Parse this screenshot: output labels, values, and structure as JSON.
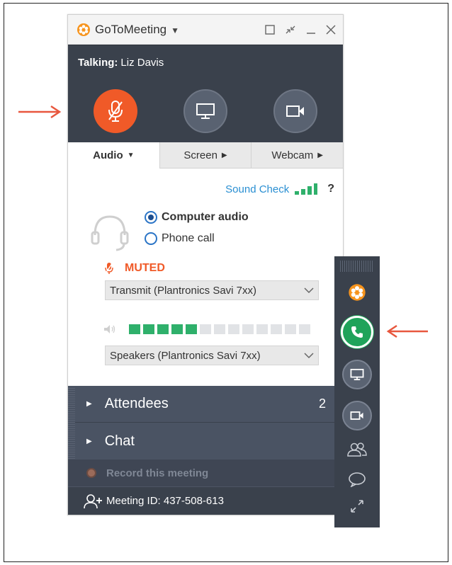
{
  "window": {
    "app_name": "GoToMeeting",
    "talking_label": "Talking:",
    "talking_name": "Liz Davis"
  },
  "tabs": [
    {
      "label": "Audio",
      "active": true
    },
    {
      "label": "Screen",
      "active": false
    },
    {
      "label": "Webcam",
      "active": false
    }
  ],
  "audio": {
    "sound_check": "Sound Check",
    "help": "?",
    "option_computer": "Computer audio",
    "option_phone": "Phone call",
    "selected": "Computer audio",
    "muted_label": "MUTED",
    "transmit_device": "Transmit (Plantronics Savi 7xx)",
    "speaker_device": "Speakers (Plantronics Savi 7xx)",
    "volume_level_segments": 5,
    "volume_total_segments": 13
  },
  "panels": {
    "attendees_label": "Attendees",
    "attendees_count": "2",
    "chat_label": "Chat",
    "record_label": "Record this meeting",
    "meeting_id": "Meeting ID: 437-508-613"
  },
  "icons": {
    "logo": "gotomeeting-logo-icon",
    "mic": "mic-muted-icon",
    "screen": "screen-icon",
    "webcam": "webcam-icon",
    "phone": "phone-icon",
    "attendees": "people-icon",
    "chat": "chat-bubble-icon",
    "expand": "expand-icon"
  },
  "colors": {
    "accent_orange": "#f05a28",
    "call_green": "#1fa35a",
    "link_blue": "#2a8fd2",
    "dark_panel": "#3a414c",
    "annotation_red": "#e8573e"
  }
}
